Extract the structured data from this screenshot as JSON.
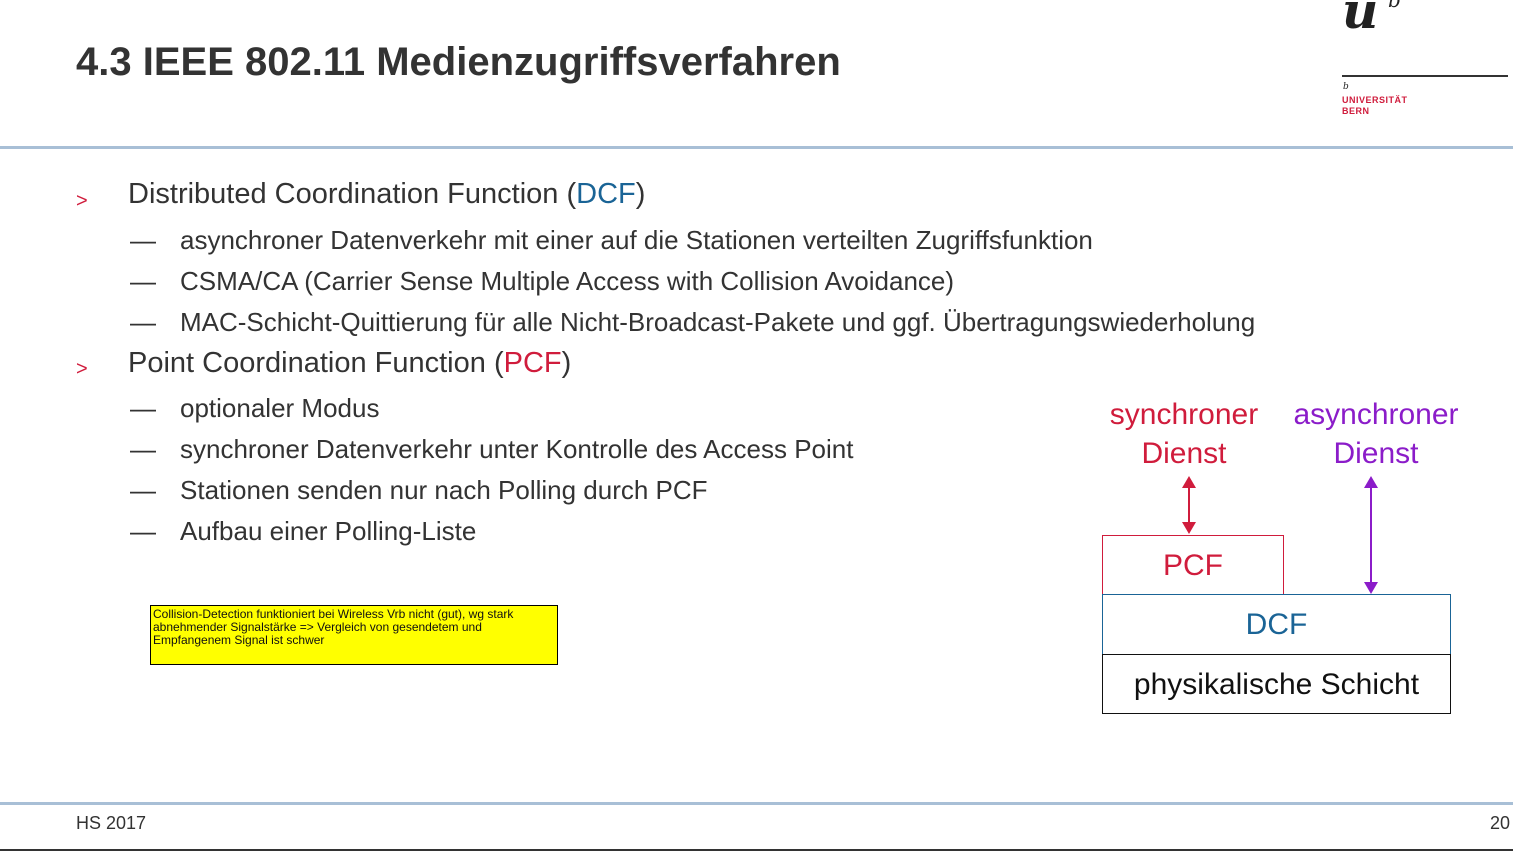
{
  "header": {
    "top_text": "",
    "title": "4.3 IEEE 802.11 Medienzugriffsverfahren",
    "logo": {
      "mark": "u",
      "superscript": "b",
      "small_b": "b",
      "line1": "UNIVERSITÄT",
      "line2": "BERN"
    }
  },
  "content": {
    "dcf": {
      "bullet": ">",
      "prefix": "Distributed Coordination Function (",
      "abbr": "DCF",
      "suffix": ")",
      "items": [
        "asynchroner Datenverkehr mit einer auf die Stationen verteilten Zugriffsfunktion",
        "CSMA/CA (Carrier Sense Multiple Access with Collision Avoidance)",
        "MAC-Schicht-Quittierung für alle Nicht-Broadcast-Pakete und ggf. Übertragungswiederholung"
      ]
    },
    "pcf": {
      "bullet": ">",
      "prefix": "Point Coordination Function (",
      "abbr": "PCF",
      "suffix": ")",
      "items": [
        "optionaler Modus",
        "synchroner Datenverkehr unter Kontrolle des Access Point",
        "Stationen senden nur nach Polling durch PCF",
        "Aufbau einer Polling-Liste"
      ]
    },
    "dash": "—",
    "note": "Collision-Detection funktioniert bei Wireless Vrb nicht (gut), wg stark abnehmender Signalstärke => Vergleich von gesendetem und Empfangenem Signal ist schwer"
  },
  "diagram": {
    "sync_line1": "synchroner",
    "sync_line2": "Dienst",
    "async_line1": "asynchroner",
    "async_line2": "Dienst",
    "pcf_box": "PCF",
    "dcf_box": "DCF",
    "phy_box": "physikalische Schicht",
    "colors": {
      "sync": "#d01c3c",
      "async": "#8b1cc9",
      "dcf": "#1a6496"
    }
  },
  "footer": {
    "left": "HS 2017",
    "page": "20"
  }
}
